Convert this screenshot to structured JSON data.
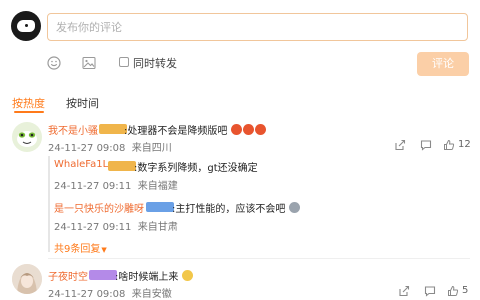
{
  "composer": {
    "placeholder": "发布你的评论",
    "repost_label": "同时转发",
    "submit_label": "评论",
    "emoji_icon": "smiley-icon",
    "image_icon": "image-icon"
  },
  "sort_tabs": [
    {
      "label": "按热度",
      "active": true
    },
    {
      "label": "按时间",
      "active": false
    }
  ],
  "comments": [
    {
      "user": "我不是小骚",
      "text": ":处理器不会是降频版吧",
      "time": "24-11-27 09:08",
      "location": "来自四川",
      "likes": "12",
      "replies": [
        {
          "user": "WhaleFa1L",
          "text": ":数字系列降频，gt还没确定",
          "time": "24-11-27 09:11",
          "location": "来自福建"
        },
        {
          "user": "是一只快乐的沙雕呀",
          "text": ":主打性能的，应该不会吧",
          "time": "24-11-27 09:11",
          "location": "来自甘肃"
        }
      ],
      "more_replies": "共9条回复"
    },
    {
      "user": "子夜时空",
      "text": ":啥时候端上来",
      "time": "24-11-27 09:08",
      "location": "来自安徽",
      "likes": "5"
    }
  ],
  "colors": {
    "accent": "#ff7a1a",
    "username": "#ef6a2f",
    "submit_bg": "#fbcfa7",
    "input_border": "#f1c69b"
  }
}
